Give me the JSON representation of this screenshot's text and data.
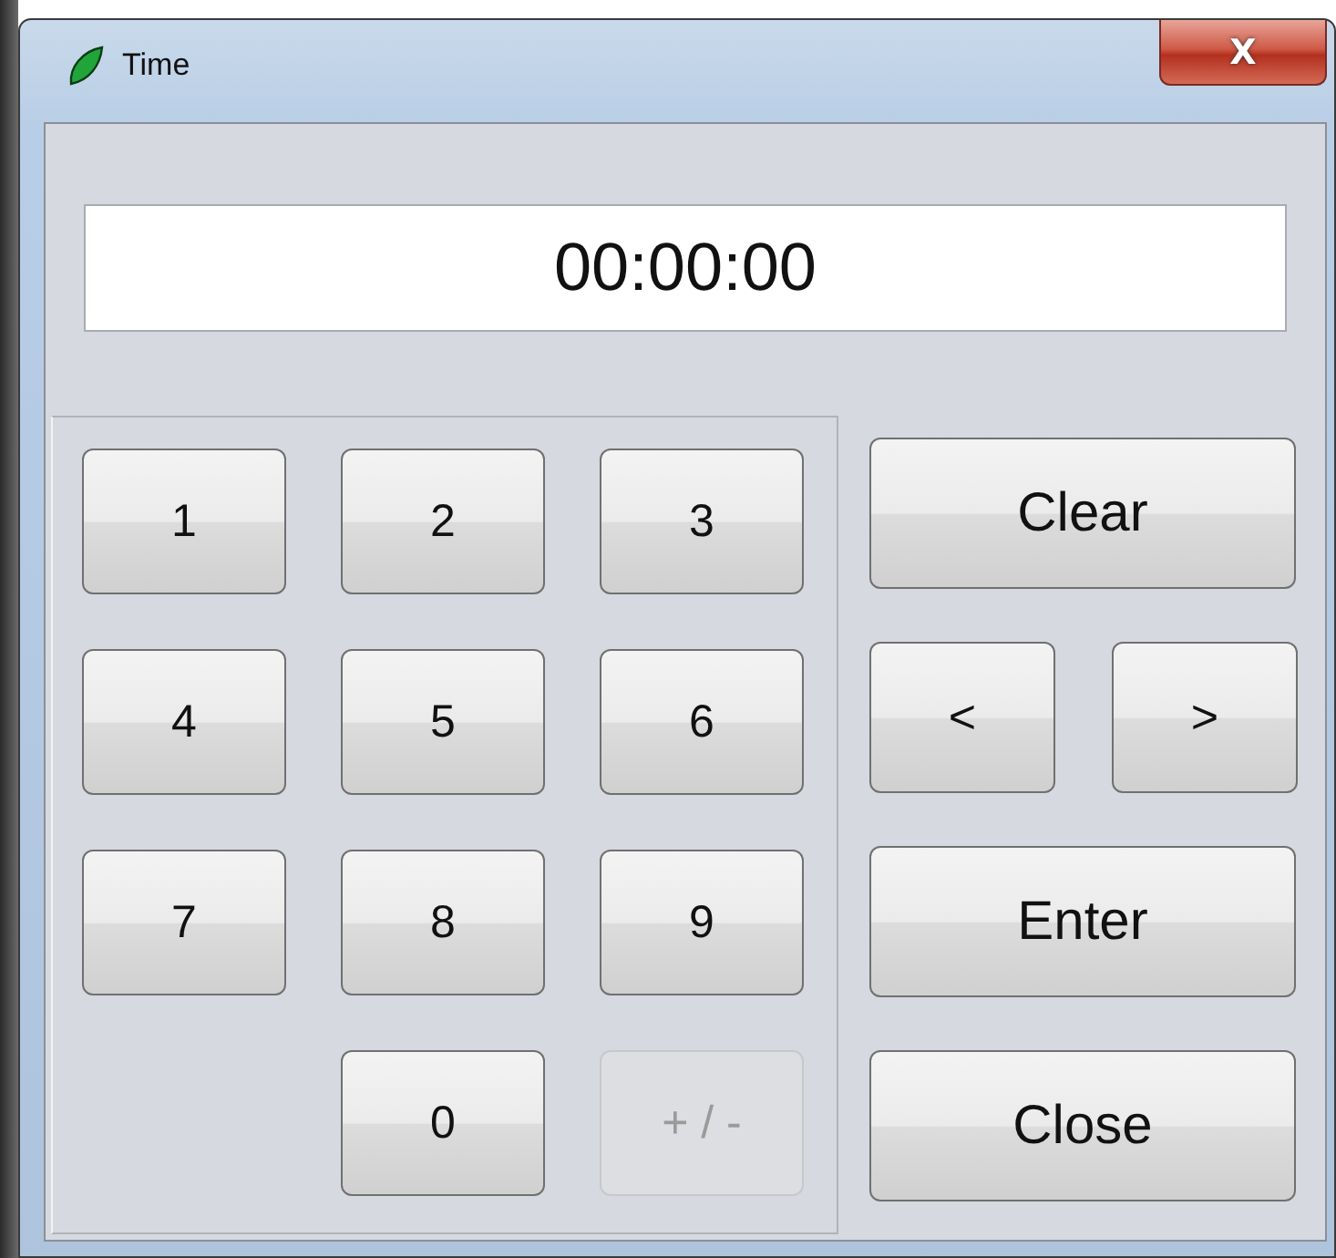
{
  "window": {
    "title": "Time",
    "close": "X"
  },
  "display": {
    "value": "00:00:00"
  },
  "keypad": [
    {
      "keys": [
        {
          "label": "1",
          "disabled": false
        },
        {
          "label": "2",
          "disabled": false
        },
        {
          "label": "3",
          "disabled": false
        }
      ]
    },
    {
      "keys": [
        {
          "label": "4",
          "disabled": false
        },
        {
          "label": "5",
          "disabled": false
        },
        {
          "label": "6",
          "disabled": false
        }
      ]
    },
    {
      "keys": [
        {
          "label": "7",
          "disabled": false
        },
        {
          "label": "8",
          "disabled": false
        },
        {
          "label": "9",
          "disabled": false
        }
      ]
    },
    {
      "keys": [
        {
          "label": "0",
          "disabled": false
        },
        {
          "label": "+ / -",
          "disabled": true
        }
      ]
    }
  ],
  "actions": [
    {
      "kind": "single",
      "buttons": [
        {
          "label": "Clear"
        }
      ]
    },
    {
      "kind": "pair",
      "buttons": [
        {
          "label": "<"
        },
        {
          "label": ">"
        }
      ]
    },
    {
      "kind": "single",
      "buttons": [
        {
          "label": "Enter"
        }
      ]
    },
    {
      "kind": "single",
      "buttons": [
        {
          "label": "Close"
        }
      ]
    }
  ]
}
